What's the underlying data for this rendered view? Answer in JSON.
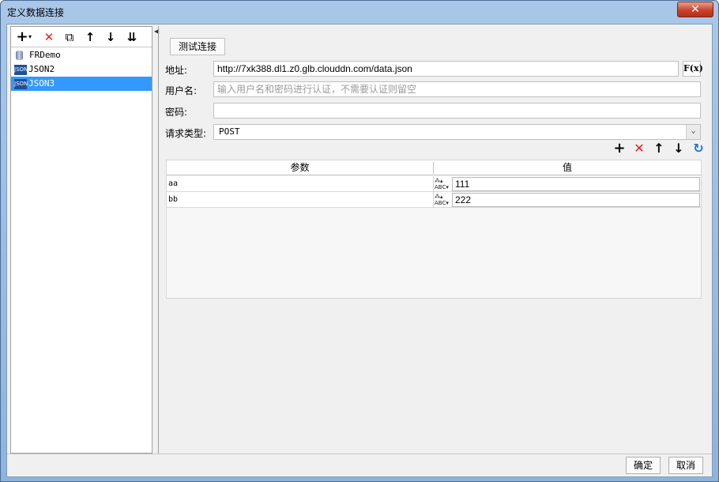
{
  "window": {
    "title": "定义数据连接",
    "close_label": "✕"
  },
  "left_toolbar": {
    "add": "+",
    "add_dropdown": "▾",
    "delete": "✕",
    "copy": "⧉",
    "up": "↑",
    "down": "↓",
    "sort": "⇊"
  },
  "tree": {
    "items": [
      {
        "label": "FRDemo",
        "icon": "database-icon",
        "selected": false
      },
      {
        "label": "JSON2",
        "icon": "json-icon",
        "selected": false
      },
      {
        "label": "JSON3",
        "icon": "json-icon",
        "selected": true
      }
    ],
    "json_icon_text": "JSON"
  },
  "form": {
    "test_button": "测试连接",
    "url_label": "地址:",
    "url_value": "http://7xk388.dl1.z0.glb.clouddn.com/data.json",
    "fx_label": "F(x)",
    "username_label": "用户名:",
    "username_placeholder": "输入用户名和密码进行认证，不需要认证则留空",
    "password_label": "密码:",
    "request_type_label": "请求类型:",
    "request_type_value": "POST",
    "dropdown_arrow": "⌄"
  },
  "param_toolbar": {
    "add": "+",
    "delete": "✕",
    "up": "↑",
    "down": "↓",
    "refresh": "↻"
  },
  "params": {
    "headers": [
      "参数",
      "值"
    ],
    "type_icon_text": "ABC",
    "rows": [
      {
        "name": "aa",
        "value": "111"
      },
      {
        "name": "bb",
        "value": "222"
      }
    ]
  },
  "footer": {
    "ok": "确定",
    "cancel": "取消"
  },
  "colors": {
    "selection": "#3399ff",
    "delete_red": "#e02020",
    "refresh_blue": "#1e73d2"
  }
}
